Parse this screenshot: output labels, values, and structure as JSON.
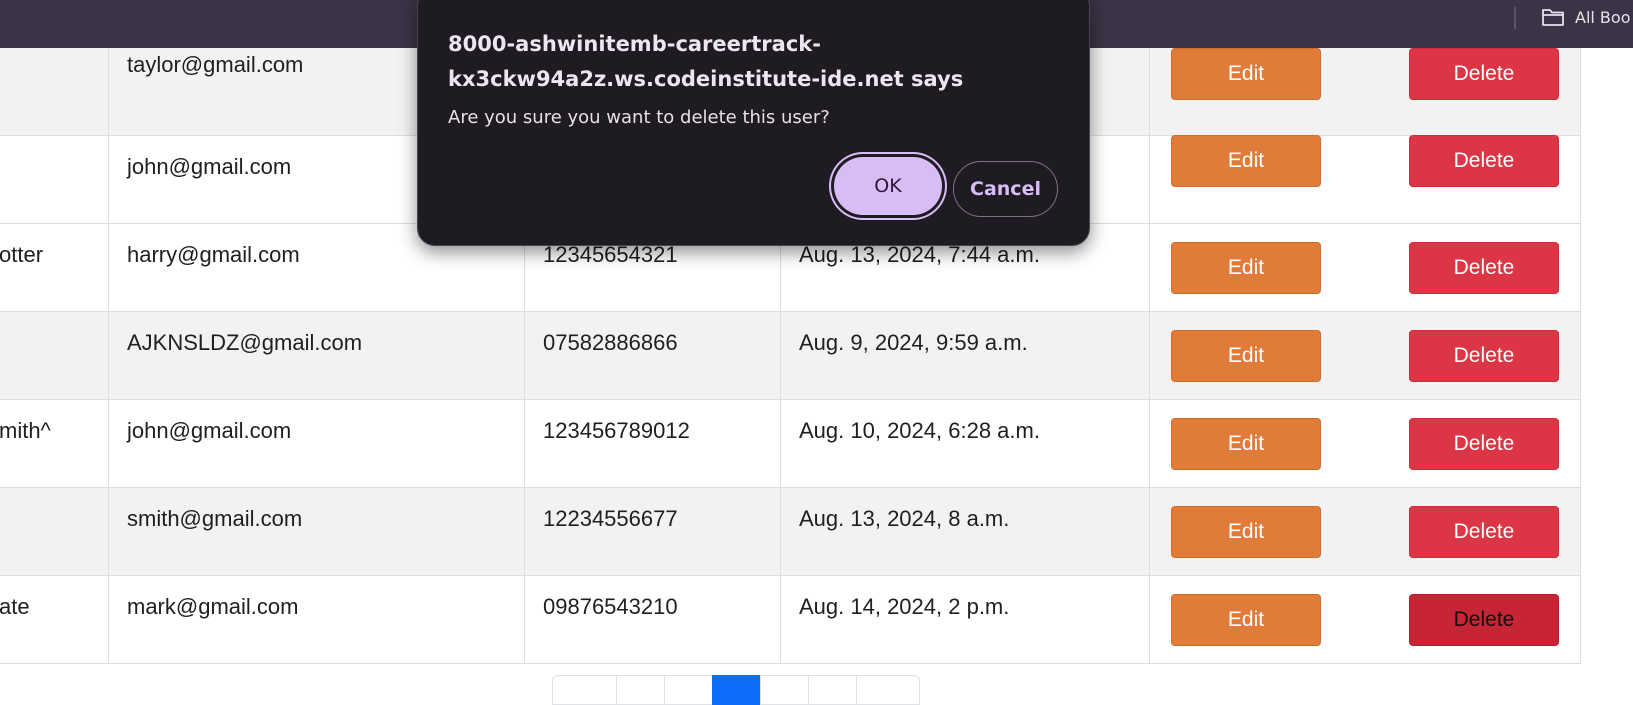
{
  "bookmarks_bar": {
    "folder_label": "All Boo"
  },
  "table": {
    "rows": [
      {
        "name": "",
        "email": "taylor@gmail.com",
        "phone": "",
        "date": "",
        "edit": "Edit",
        "delete": "Delete"
      },
      {
        "name": "",
        "email": "john@gmail.com",
        "phone": "",
        "date": "",
        "edit": "Edit",
        "delete": "Delete"
      },
      {
        "name": "otter",
        "email": "harry@gmail.com",
        "phone": "12345654321",
        "date": "Aug. 13, 2024, 7:44 a.m.",
        "edit": "Edit",
        "delete": "Delete"
      },
      {
        "name": "",
        "email": "AJKNSLDZ@gmail.com",
        "phone": "07582886866",
        "date": "Aug. 9, 2024, 9:59 a.m.",
        "edit": "Edit",
        "delete": "Delete"
      },
      {
        "name": "mith^",
        "email": "john@gmail.com",
        "phone": "123456789012",
        "date": "Aug. 10, 2024, 6:28 a.m.",
        "edit": "Edit",
        "delete": "Delete"
      },
      {
        "name": "",
        "email": "smith@gmail.com",
        "phone": "12234556677",
        "date": "Aug. 13, 2024, 8 a.m.",
        "edit": "Edit",
        "delete": "Delete"
      },
      {
        "name": "ate",
        "email": "mark@gmail.com",
        "phone": "09876543210",
        "date": "Aug. 14, 2024, 2 p.m.",
        "edit": "Edit",
        "delete": "Delete"
      }
    ]
  },
  "pagination": {
    "active_index": 3
  },
  "dialog": {
    "origin": "8000-ashwinitemb-careertrack-kx3ckw94a2z.ws.codeinstitute-ide.net says",
    "message": "Are you sure you want to delete this user?",
    "ok_label": "OK",
    "cancel_label": "Cancel"
  },
  "colors": {
    "edit_button": "#e17b3a",
    "delete_button": "#dc3545",
    "delete_button_hover": "#c72536",
    "pagination_active": "#0d6efd",
    "dialog_background": "#1f1b22",
    "dialog_ok": "#d8bcf6",
    "topbar": "#3c3346"
  }
}
